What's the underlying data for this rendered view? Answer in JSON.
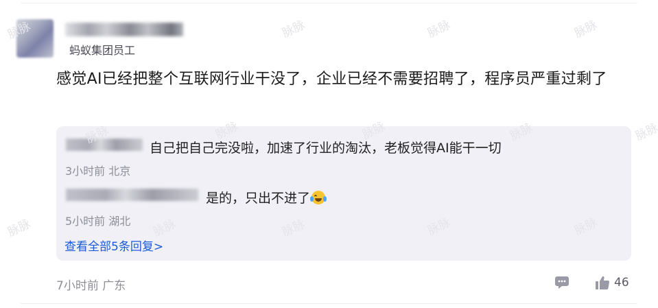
{
  "post": {
    "company": "蚂蚁集团员工",
    "body": "感觉AI已经把整个互联网行业干没了，企业已经不需要招聘了，程序员严重过剩了",
    "time_location": "7小时前 广东",
    "like_count": "46"
  },
  "replies": {
    "items": [
      {
        "text": "自己把自己完没啦，加速了行业的淘汰，老板觉得AI能干一切",
        "meta": "3小时前 北京"
      },
      {
        "text": "是的，只出不进了",
        "meta": "5小时前 湖北",
        "emoji": "crying-laughing-emoji"
      }
    ],
    "view_all_label": "查看全部5条回复>"
  },
  "watermark": "脉脉",
  "colors": {
    "link": "#1a5bd6",
    "reply_bg": "#f0f0f6",
    "meta": "#8e8e98"
  }
}
